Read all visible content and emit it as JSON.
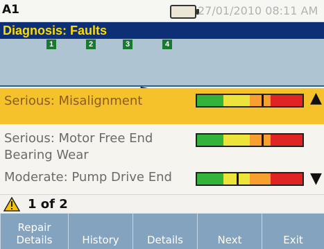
{
  "status": {
    "left_label": "A1",
    "datetime": "27/01/2010 08:11 AM"
  },
  "title": "Diagnosis: Faults",
  "diagram": {
    "points": [
      "1",
      "2",
      "3",
      "4"
    ]
  },
  "faults": [
    {
      "label": "Serious:  Misalignment",
      "severity_position": 0.62,
      "selected": true
    },
    {
      "label": "Serious: Motor Free End\nBearing Wear",
      "severity_position": 0.62,
      "selected": false
    },
    {
      "label": "Moderate: Pump Drive End",
      "severity_position": 0.38,
      "selected": false
    }
  ],
  "severity_scale_colors": [
    "#33b33a",
    "#ece43a",
    "#f7a02f",
    "#e02424"
  ],
  "page_indicator": "1 of 2",
  "softkeys": [
    {
      "label": "Repair\nDetails"
    },
    {
      "label": "History"
    },
    {
      "label": "Details"
    },
    {
      "label": "Next"
    },
    {
      "label": "Exit"
    }
  ],
  "icons": {
    "warning": "warning-icon",
    "scroll_up": "up-arrow-icon",
    "scroll_down": "down-arrow-icon"
  }
}
